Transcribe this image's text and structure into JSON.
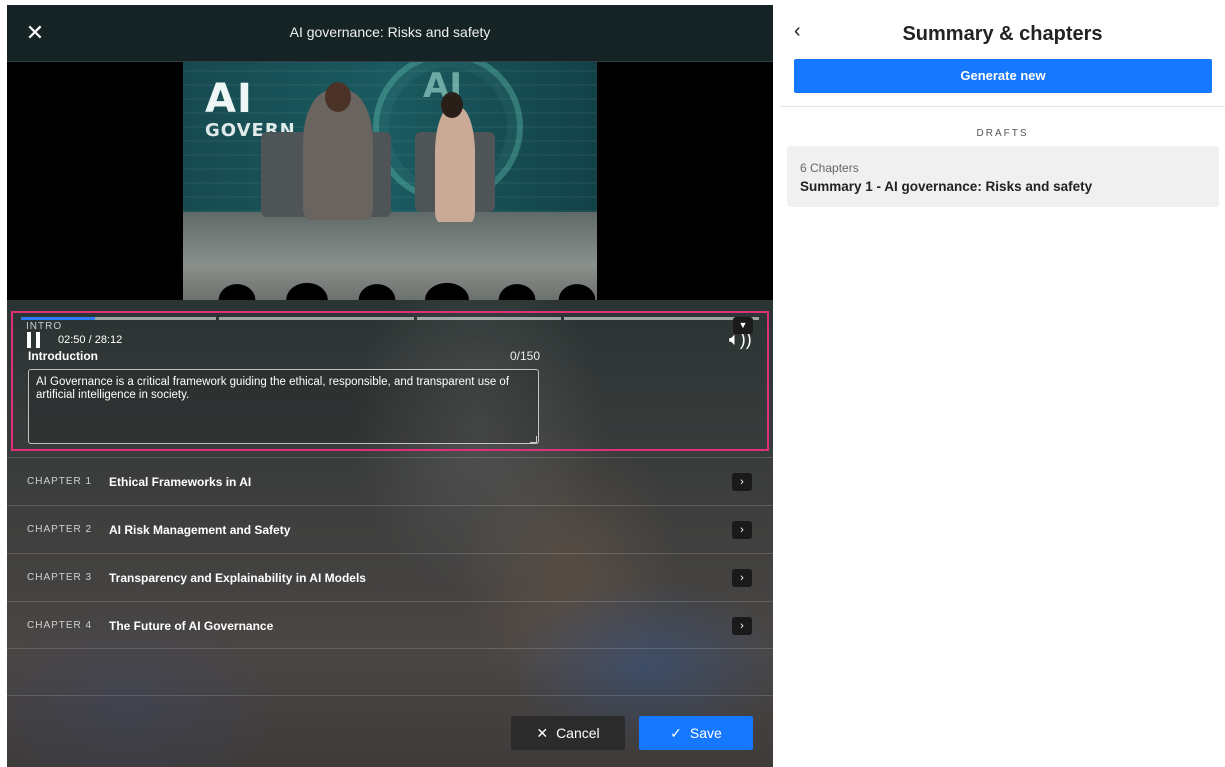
{
  "editor": {
    "close_icon": "close-icon",
    "title": "AI governance: Risks and safety",
    "video": {
      "brand_ai": "AI",
      "brand_gov": "GOVERN",
      "backdrop_ring_text": "AI",
      "time": "02:50 / 28:12",
      "progress_fraction": 0.1,
      "pause_icon": "pause-icon",
      "volume_icon": "volume-icon",
      "volume_glyph": "🔈︎))"
    },
    "intro": {
      "tag": "INTRO",
      "title": "Introduction",
      "char_count": "0/150",
      "text": "AI Governance is a critical framework guiding the ethical, responsible, and transparent use of artificial intelligence in society.",
      "highlight_color": "#e0307a"
    },
    "chapters": [
      {
        "num": "CHAPTER 1",
        "title": "Ethical Frameworks in AI"
      },
      {
        "num": "CHAPTER 2",
        "title": "AI Risk Management and Safety"
      },
      {
        "num": "CHAPTER 3",
        "title": "Transparency and Explainability in AI Models"
      },
      {
        "num": "CHAPTER 4",
        "title": "The Future of AI Governance"
      }
    ],
    "buttons": {
      "cancel": "Cancel",
      "save": "Save"
    }
  },
  "sidebar": {
    "title": "Summary & chapters",
    "generate_label": "Generate new",
    "drafts_label": "DRAFTS",
    "draft": {
      "chapters": "6 Chapters",
      "name": "Summary 1 - AI governance: Risks and safety"
    }
  },
  "colors": {
    "accent": "#1677ff",
    "highlight": "#e0307a",
    "progress": "#2f7bf5"
  }
}
